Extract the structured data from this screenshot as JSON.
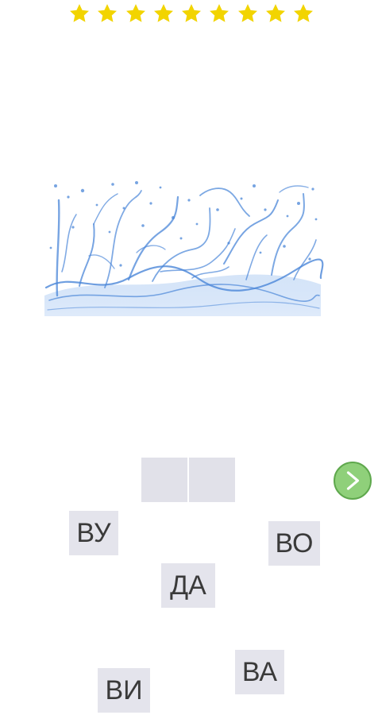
{
  "rating": {
    "stars": 9,
    "star_color": "#f2d400",
    "icon": "star-icon"
  },
  "picture": {
    "subject": "water splash",
    "color": "#4a86d8"
  },
  "answer": {
    "slot_count": 2,
    "slot_color": "#e1e1e9"
  },
  "next_button": {
    "icon": "chevron-right-icon",
    "color": "#8fd07a"
  },
  "tiles": [
    "ВУ",
    "ВО",
    "ДА",
    "ВА",
    "ВИ"
  ]
}
